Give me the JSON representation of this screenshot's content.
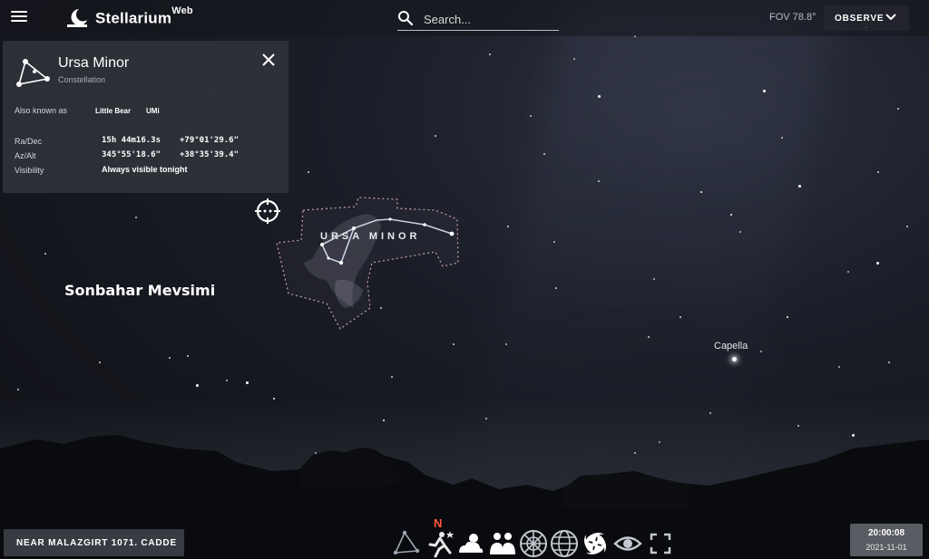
{
  "header": {
    "brand": "Stellarium",
    "brand_sup": "Web",
    "search_placeholder": "Search...",
    "fov": "FOV 78.8°",
    "observe_label": "OBSERVE"
  },
  "info_panel": {
    "title": "Ursa Minor",
    "subtitle": "Constellation",
    "also_known_label": "Also known as",
    "aliases": [
      "Little Bear",
      "UMi"
    ],
    "radec_label": "Ra/Dec",
    "ra": "15h 44m16.3s",
    "dec": "+79°01'29.6\"",
    "azalt_label": "Az/Alt",
    "az": "345°55'18.6\"",
    "alt": "+38°35'39.4\"",
    "visibility_label": "Visibility",
    "visibility": "Always visible tonight"
  },
  "sky": {
    "constellation_label": "URSA MINOR",
    "season_text": "Sonbahar Mevsimi",
    "star_label": "Capella"
  },
  "footer": {
    "location": "NEAR MALAZGIRT 1071. CADDE",
    "compass": "N",
    "time": "20:00:08",
    "date": "2021-11-01"
  },
  "toolbar_icons": [
    "constellations-lines-icon",
    "constellation-art-icon",
    "atmosphere-icon",
    "landscape-icon",
    "azimuthal-grid-icon",
    "equatorial-grid-icon",
    "deep-sky-objects-icon",
    "night-mode-icon",
    "fullscreen-icon"
  ]
}
